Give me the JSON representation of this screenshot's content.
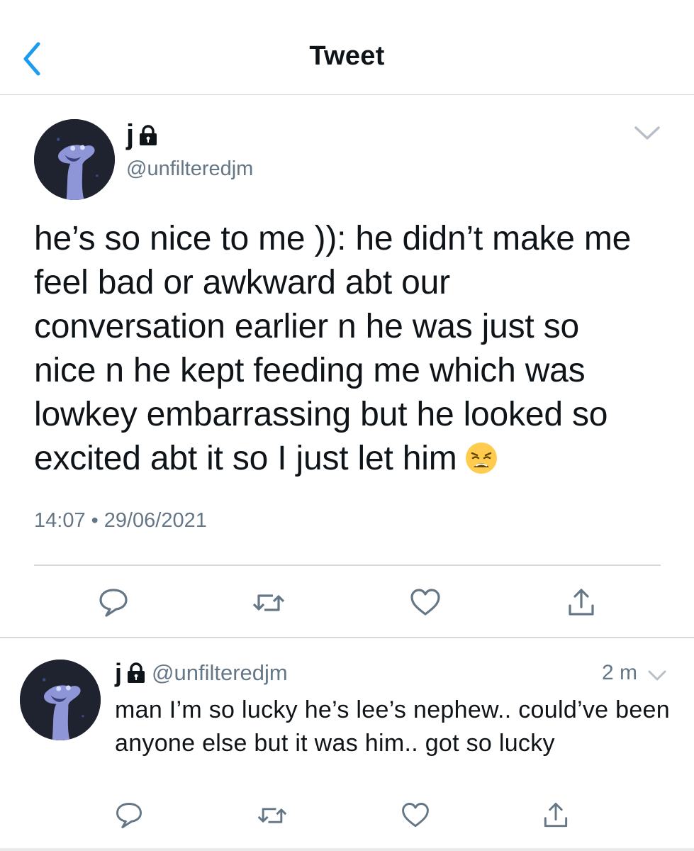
{
  "header": {
    "title": "Tweet",
    "back_icon": "chevron-left-icon"
  },
  "colors": {
    "accent": "#1d9bf0",
    "muted": "#657786",
    "text": "#0f1419",
    "divider": "#d5d9dd"
  },
  "main_tweet": {
    "display_name": "j",
    "protected_icon": "lock-icon",
    "handle": "@unfilteredjm",
    "text": "he’s so nice to me )): he didn’t make me\nfeel bad or awkward abt our\nconversation earlier n he was just so\nnice n he kept feeding me which was\nlowkey embarrassing but he looked so\nexcited abt it so I just let him",
    "emoji": "weary-face",
    "time": "14:07",
    "date": "29/06/2021"
  },
  "reply_tweet": {
    "display_name": "j",
    "protected_icon": "lock-icon",
    "handle": "@unfilteredjm",
    "time_ago": "2 m",
    "text": "man I’m so lucky he’s lee’s nephew.. could’ve been anyone else but it was him.. got so lucky"
  },
  "actions": [
    "reply-icon",
    "retweet-icon",
    "like-icon",
    "share-icon"
  ]
}
